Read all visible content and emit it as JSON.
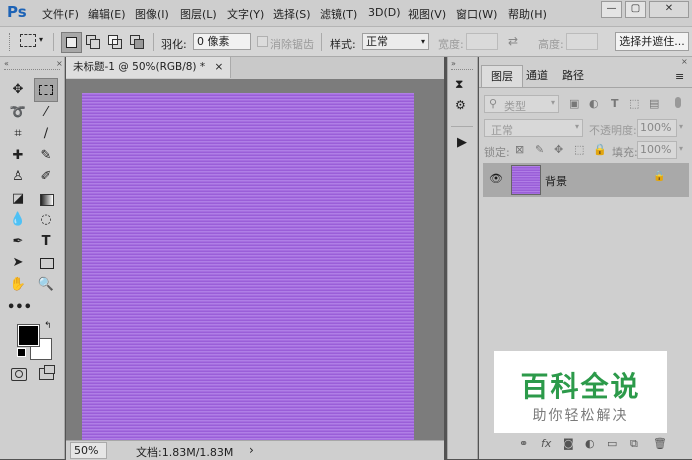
{
  "app": {
    "logo": "Ps"
  },
  "menu": [
    "文件(F)",
    "编辑(E)",
    "图像(I)",
    "图层(L)",
    "文字(Y)",
    "选择(S)",
    "滤镜(T)",
    "3D(D)",
    "视图(V)",
    "窗口(W)",
    "帮助(H)"
  ],
  "window_controls": {
    "minimize": "—",
    "restore": "▢",
    "close": "✕"
  },
  "options": {
    "feather_label": "羽化:",
    "feather_value": "0 像素",
    "antialias_label": "消除锯齿",
    "style_label": "样式:",
    "style_value": "正常",
    "width_label": "宽度:",
    "height_label": "高度:",
    "select_mask_button": "选择并遮住..."
  },
  "document": {
    "tab_title": "未标题-1 @ 50%(RGB/8) *",
    "close_glyph": "×",
    "zoom": "50%",
    "doc_info": "文档:1.83M/1.83M",
    "status_arrow": "›"
  },
  "layers_panel": {
    "tabs": [
      "图层",
      "通道",
      "路径"
    ],
    "filter_label": "类型",
    "blend_mode": "正常",
    "opacity_label": "不透明度:",
    "opacity_value": "100%",
    "lock_label": "锁定:",
    "fill_label": "填充:",
    "fill_value": "100%",
    "layer_name": "背景"
  },
  "watermark": {
    "big": "百科全说",
    "small": "助你轻松解决"
  },
  "colors": {
    "accent": "#1d63b6",
    "canvas_light": "#b07fe6",
    "canvas_dark": "#9a5ed8",
    "watermark_green": "#2c9a4a"
  },
  "tools": [
    "move-icon",
    "rect-marquee-icon",
    "lasso-icon",
    "magic-wand-icon",
    "crop-icon",
    "eyedropper-icon",
    "healing-brush-icon",
    "brush-icon",
    "clone-stamp-icon",
    "history-brush-icon",
    "eraser-icon",
    "gradient-icon",
    "blur-icon",
    "dodge-icon",
    "pen-icon",
    "type-icon",
    "path-select-icon",
    "rectangle-shape-icon",
    "hand-icon",
    "zoom-icon",
    "more-tools-icon"
  ]
}
